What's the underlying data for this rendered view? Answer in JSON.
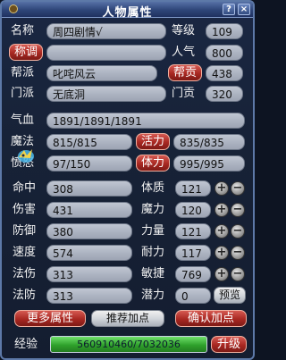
{
  "window": {
    "title": "人物属性",
    "help": "?",
    "close": "×"
  },
  "identity": {
    "name_label": "名称",
    "name_value": "周四剧情√",
    "level_label": "等级",
    "level_value": "109",
    "title_button": "称调",
    "title_value": "",
    "popularity_label": "人气",
    "popularity_value": "800",
    "gang_label": "帮派",
    "gang_value": "叱咤风云",
    "gang_contrib_button": "帮贡",
    "gang_contrib_value": "438",
    "school_label": "门派",
    "school_value": "无底洞",
    "school_contrib_label": "门贡",
    "school_contrib_value": "320"
  },
  "vitals": {
    "hp_label": "气血",
    "hp_value": "1891/1891/1891",
    "mp_label": "魔法",
    "mp_value": "815/815",
    "vigor_button": "活力",
    "vigor_value": "835/835",
    "anger_label": "愤怒",
    "anger_value": "97/150",
    "stamina_button": "体力",
    "stamina_value": "995/995"
  },
  "combat": [
    {
      "label": "命中",
      "value": "308"
    },
    {
      "label": "伤害",
      "value": "431"
    },
    {
      "label": "防御",
      "value": "380"
    },
    {
      "label": "速度",
      "value": "574"
    },
    {
      "label": "法伤",
      "value": "313"
    },
    {
      "label": "法防",
      "value": "313"
    }
  ],
  "attributes": [
    {
      "label": "体质",
      "value": "121"
    },
    {
      "label": "魔力",
      "value": "120"
    },
    {
      "label": "力量",
      "value": "121"
    },
    {
      "label": "耐力",
      "value": "117"
    },
    {
      "label": "敏捷",
      "value": "769"
    }
  ],
  "potential": {
    "label": "潜力",
    "value": "0",
    "preview_button": "预览"
  },
  "buttons": {
    "more": "更多属性",
    "recommend": "推荐加点",
    "confirm": "确认加点",
    "upgrade": "升级"
  },
  "experience": {
    "label": "经验",
    "value": "560910460/7032036"
  },
  "adjust": {
    "plus": "+",
    "minus": "−"
  }
}
